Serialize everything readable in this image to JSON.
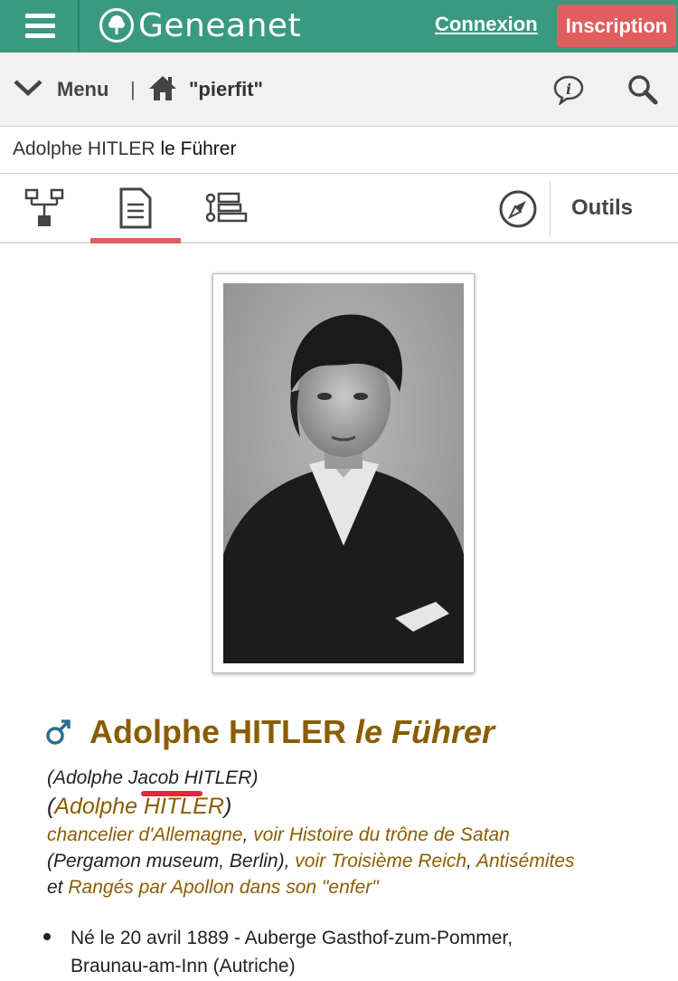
{
  "header": {
    "logo_text": "Geneanet",
    "connexion_label": "Connexion",
    "inscription_label": "Inscription",
    "brand_color": "#3a9a80",
    "accent_color": "#e25e5e"
  },
  "menubar": {
    "menu_label": "Menu",
    "separator": "|",
    "tree_owner": "\"pierfit\""
  },
  "breadcrumb": {
    "name": "Adolphe HITLER",
    "nickname": "le Führer"
  },
  "tabs": {
    "items": [
      {
        "icon": "family-tree-icon"
      },
      {
        "icon": "document-icon",
        "active": true
      },
      {
        "icon": "timeline-list-icon"
      }
    ],
    "tools_label": "Outils"
  },
  "person": {
    "name": "Adolphe HITLER",
    "nickname": "le Führer",
    "gender_symbol": "♂",
    "alt_name": "(Adolphe Jacob HITLER)",
    "alt_link_open": "(",
    "alt_link_name": "Adolphe HITLER",
    "alt_link_close": ")",
    "desc": {
      "link1": "chancelier d'Allemagne",
      "sep1": ", ",
      "link2": "voir Histoire du trône de Satan",
      "text1": " (Pergamon museum, Berlin), ",
      "link3": "voir Troisième Reich",
      "sep2": ", ",
      "link4": "Antisémites",
      "text2": " et ",
      "link5": "Rangés par Apollon dans son \"enfer\""
    },
    "birth_line1": "Né le 20 avril 1889 - Auberge Gasthof-zum-Pommer,",
    "birth_line2": "Braunau-am-Inn (Autriche)"
  }
}
